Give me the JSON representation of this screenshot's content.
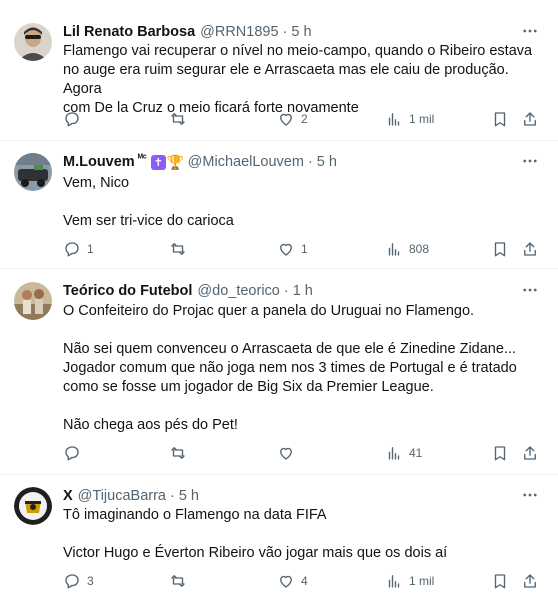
{
  "tweets": [
    {
      "name": "Lil Renato Barbosa",
      "handle": "@RRN1895",
      "separator": "·",
      "time": "5 h",
      "text": [
        "Flamengo vai recuperar o nível no meio-campo, quando o Ribeiro estava",
        "no auge era ruim segurar ele e Arrascaeta mas ele caiu de produção. Agora",
        "com De la Cruz o meio ficará forte novamente"
      ],
      "replies": "",
      "retweets": "",
      "likes": "2",
      "views": "1 mil"
    },
    {
      "name": "M.Louvem",
      "name_suffix": "ᴹᶜ",
      "handle": "@MichaelLouvem",
      "separator": "·",
      "time": "5 h",
      "text": [
        "Vem, Nico",
        "",
        "Vem ser tri-vice do carioca"
      ],
      "replies": "1",
      "retweets": "",
      "likes": "1",
      "views": "808"
    },
    {
      "name": "Teórico do Futebol",
      "handle": "@do_teorico",
      "separator": "·",
      "time": "1 h",
      "text": [
        "O Confeiteiro do Projac quer a panela do Uruguai no Flamengo.",
        "",
        "Não sei quem convenceu o Arrascaeta de que ele é Zinedine Zidane...",
        "Jogador comum que não joga nem nos 3 times de Portugal e é tratado",
        "como se fosse um jogador de Big Six da Premier League.",
        "",
        "Não chega aos pés do Pet!"
      ],
      "replies": "",
      "retweets": "",
      "likes": "",
      "views": "41"
    },
    {
      "name": "X",
      "handle": "@TijucaBarra",
      "separator": "·",
      "time": "5 h",
      "text": [
        "Tô imaginando o Flamengo na data FIFA",
        "",
        "Victor Hugo e Éverton Ribeiro vão jogar mais que os dois aí"
      ],
      "replies": "3",
      "retweets": "",
      "likes": "4",
      "views": "1 mil"
    }
  ],
  "icons": {
    "reply": "reply-icon",
    "retweet": "retweet-icon",
    "like": "heart-icon",
    "views": "views-bar-chart-icon",
    "bookmark": "bookmark-icon",
    "share": "share-icon",
    "more": "more-dots-icon",
    "badge1": "latin-cross-icon",
    "badge2": "trophy-icon"
  },
  "colors": {
    "text": "#0f1419",
    "secondary": "#536471",
    "divider": "#eff3f4",
    "cross_badge": "#8b5cf6",
    "trophy": "#e9a400"
  }
}
